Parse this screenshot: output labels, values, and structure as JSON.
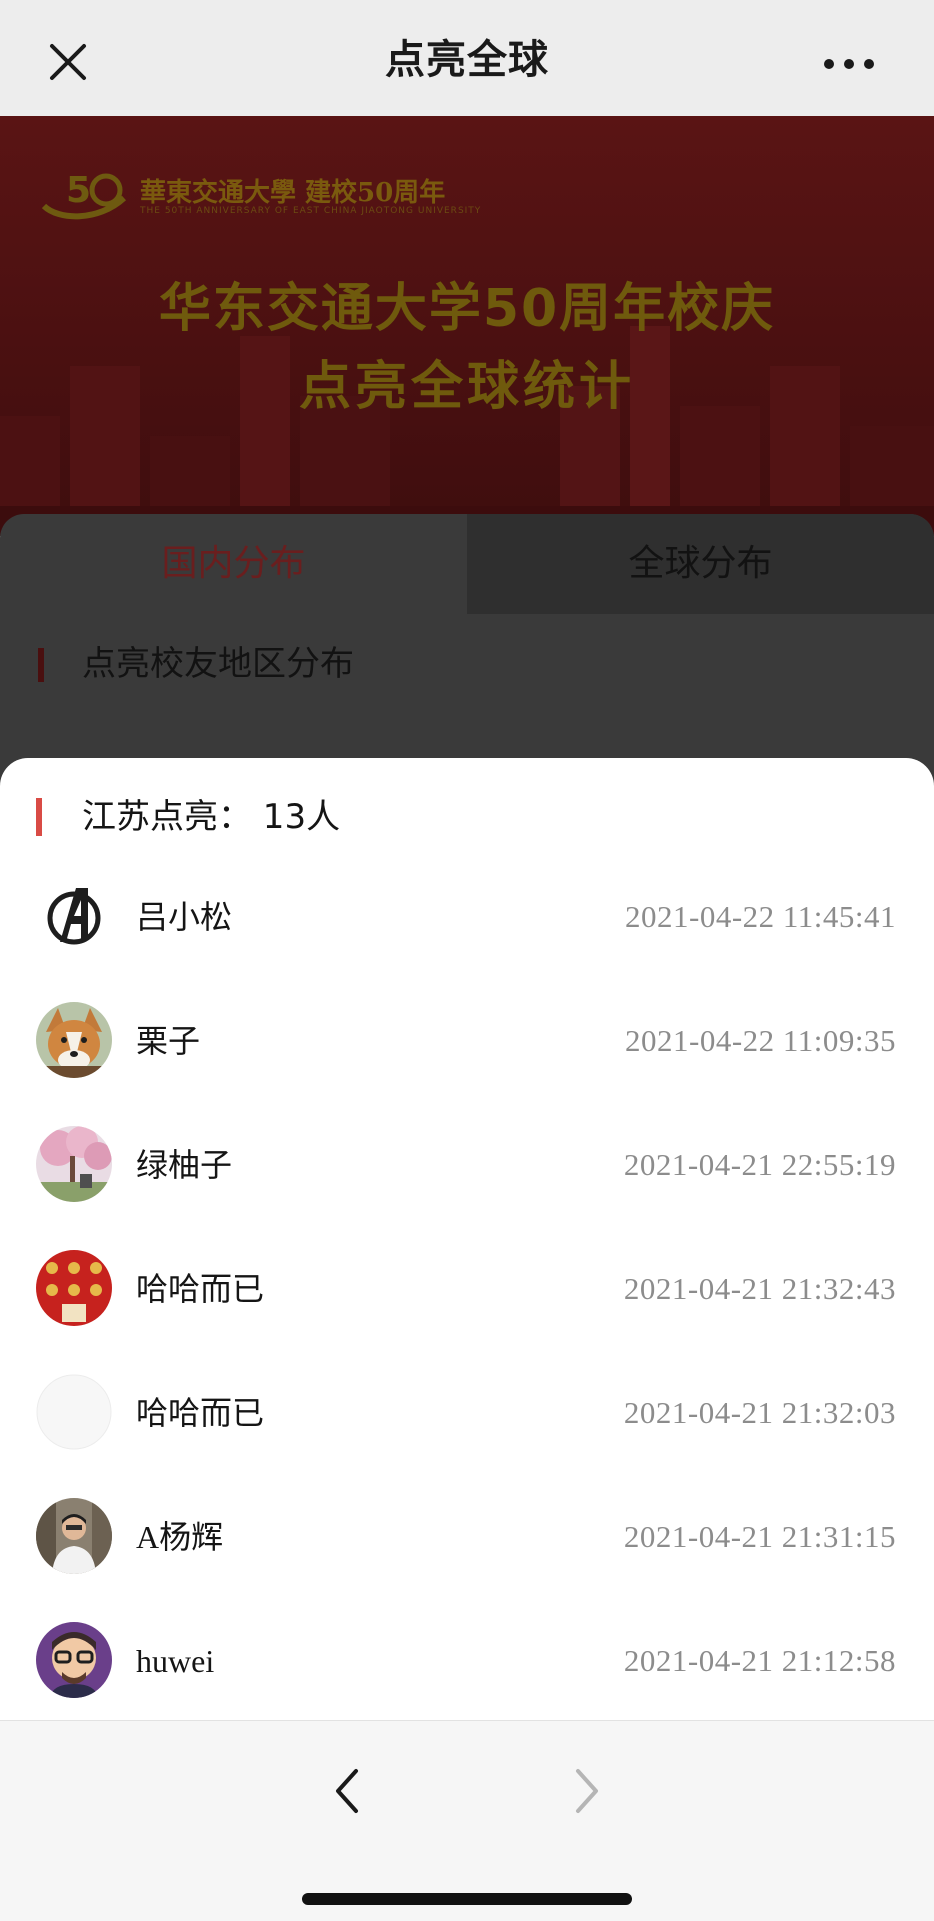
{
  "nav": {
    "title": "点亮全球",
    "close_icon": "close-icon",
    "more_icon": "more-icon"
  },
  "banner": {
    "logo_text": "華東交通大學 建校50周年",
    "logo_sub": "THE 50TH ANNIVERSARY OF EAST CHINA JIAOTONG UNIVERSITY",
    "title_line1": "华东交通大学50周年校庆",
    "title_line2": "点亮全球统计"
  },
  "tabs": {
    "domestic": "国内分布",
    "global": "全球分布"
  },
  "section": {
    "label": "点亮校友地区分布"
  },
  "sheet": {
    "title": "江苏点亮：  13人",
    "rows": [
      {
        "name": "吕小松",
        "time": "2021-04-22 11:45:41",
        "avatar": "avengers-logo"
      },
      {
        "name": "栗子",
        "time": "2021-04-22 11:09:35",
        "avatar": "corgi-dog"
      },
      {
        "name": "绿柚子",
        "time": "2021-04-21 22:55:19",
        "avatar": "cherry-blossom"
      },
      {
        "name": "哈哈而已",
        "time": "2021-04-21 21:32:43",
        "avatar": "red-poster"
      },
      {
        "name": "哈哈而已",
        "time": "2021-04-21 21:32:03",
        "avatar": "blank"
      },
      {
        "name": "A杨辉",
        "time": "2021-04-21 21:31:15",
        "avatar": "man-photo"
      },
      {
        "name": "huwei",
        "time": "2021-04-21 21:12:58",
        "avatar": "cartoon-man"
      }
    ]
  },
  "toolbar": {
    "back_icon": "chevron-left-icon",
    "forward_icon": "chevron-right-icon"
  },
  "colors": {
    "accent": "#d94b45",
    "time_text": "#8c8c8c",
    "nav_bg": "#ededed"
  }
}
